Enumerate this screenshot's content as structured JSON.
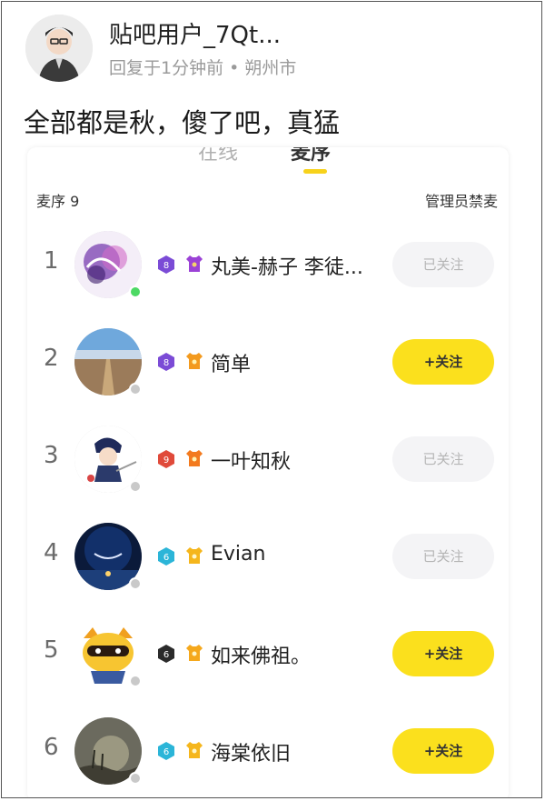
{
  "author": {
    "name": "贴吧用户_7Qt...",
    "reply_meta": "回复于1分钟前 • 朔州市"
  },
  "comment": {
    "text": "全部都是秋，傻了吧，真猛"
  },
  "card": {
    "tabs": [
      {
        "label": "在线",
        "active": false
      },
      {
        "label": "麦序",
        "active": true
      }
    ],
    "queue_label": "麦序 9",
    "admin_ban_label": "管理员禁麦",
    "colors": {
      "accent": "#fbe01d",
      "followed_bg": "#f4f4f6"
    },
    "rows": [
      {
        "rank": "1",
        "nickname": "丸美-赫子 李徒...",
        "button": "已关注",
        "followed": true,
        "level_icon": "level-purple-icon",
        "tier_icon": "shirt-purple-icon",
        "online": true
      },
      {
        "rank": "2",
        "nickname": "简单",
        "button": "+关注",
        "followed": false,
        "level_icon": "level-purple-icon",
        "tier_icon": "shirt-orange-icon",
        "online": false
      },
      {
        "rank": "3",
        "nickname": "一叶知秋",
        "button": "已关注",
        "followed": true,
        "level_icon": "level-red-icon",
        "tier_icon": "shirt-orange-icon",
        "online": false
      },
      {
        "rank": "4",
        "nickname": "Evian",
        "button": "已关注",
        "followed": true,
        "level_icon": "level-cyan-icon",
        "tier_icon": "shirt-yellow-icon",
        "online": false
      },
      {
        "rank": "5",
        "nickname": "如来佛祖。",
        "button": "+关注",
        "followed": false,
        "level_icon": "level-black-icon",
        "tier_icon": "shirt-yellow-icon",
        "online": false
      },
      {
        "rank": "6",
        "nickname": "海棠依旧",
        "button": "+关注",
        "followed": false,
        "level_icon": "level-cyan-icon",
        "tier_icon": "shirt-yellow-icon",
        "online": false
      }
    ]
  }
}
